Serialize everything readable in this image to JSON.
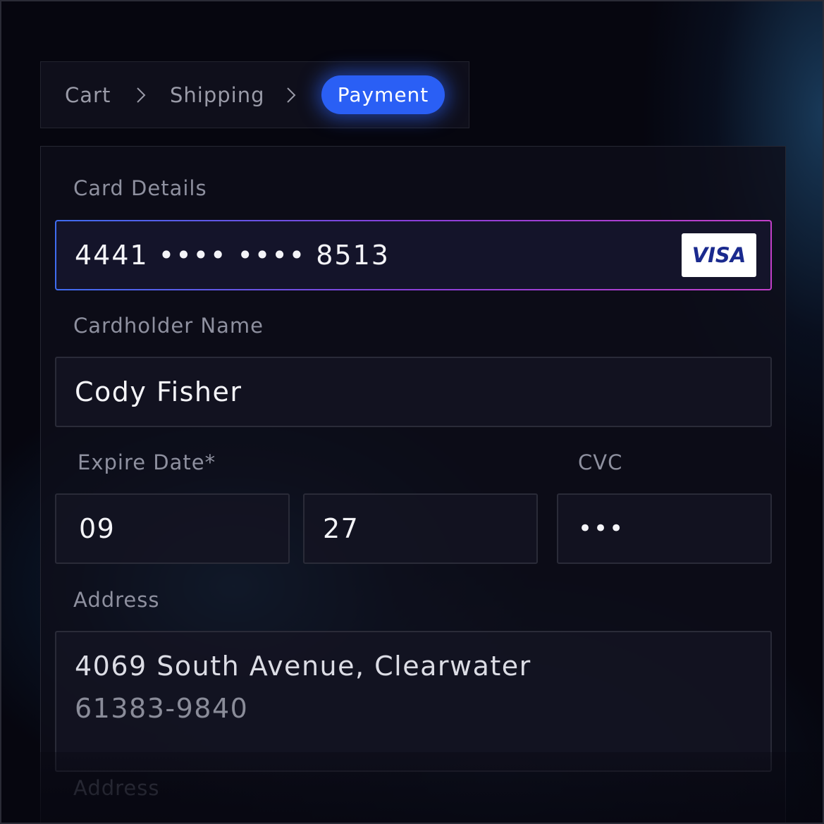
{
  "breadcrumb": {
    "steps": [
      "Cart",
      "Shipping",
      "Payment"
    ],
    "active": "Payment"
  },
  "form": {
    "card_details_label": "Card Details",
    "card_number": "4441  ••••  ••••  8513",
    "card_brand": "VISA",
    "cardholder_label": "Cardholder Name",
    "cardholder_value": "Cody Fisher",
    "expire_label": "Expire Date*",
    "expire_month": "09",
    "expire_year": "27",
    "cvc_label": "CVC",
    "cvc_value": "•••",
    "address_label": "Address",
    "address_line1": "4069 South Avenue, Clearwater",
    "address_line2": "61383-9840",
    "address2_label": "Address"
  },
  "colors": {
    "accent": "#2a5ff5",
    "background": "#06060f",
    "card_border_gradient": [
      "#3f6cf0",
      "#c23fc9"
    ],
    "visa_blue": "#1a2a8e"
  },
  "icons": {
    "separator": "chevron-right-icon",
    "card_brand": "visa-logo"
  }
}
